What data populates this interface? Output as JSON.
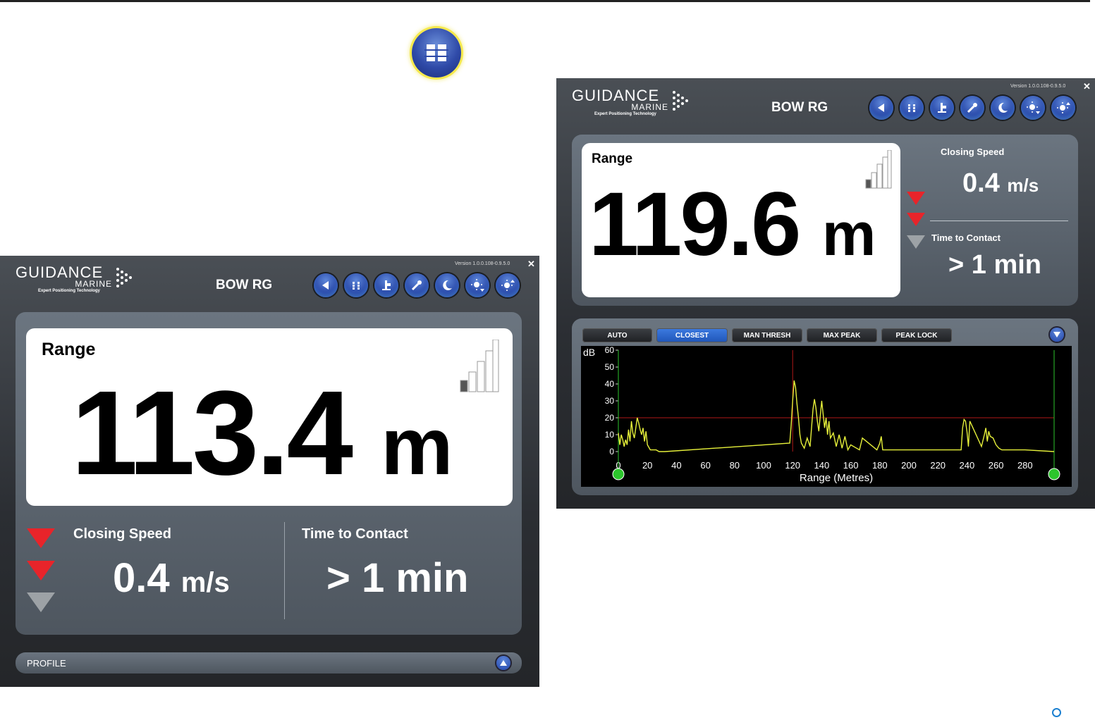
{
  "window1": {
    "logo_main": "GUIDANCE",
    "logo_sub": "MARINE",
    "logo_tag": "Expert Positioning Technology",
    "title": "BOW RG",
    "version": "Version 1.0.0.108-0.9.5.0",
    "close": "✕",
    "range_label": "Range",
    "range_value": "113.4",
    "range_unit": "m",
    "closing_speed_label": "Closing Speed",
    "closing_speed_value": "0.4",
    "closing_speed_unit": "m/s",
    "time_to_contact_label": "Time to Contact",
    "time_to_contact_value": "> 1 min",
    "profile_label": "PROFILE",
    "signal_bars_level": 1
  },
  "window2": {
    "logo_main": "GUIDANCE",
    "logo_sub": "MARINE",
    "logo_tag": "Expert Positioning Technology",
    "title": "BOW RG",
    "version": "Version 1.0.0.108-0.9.5.0",
    "close": "✕",
    "range_label": "Range",
    "range_value": "119.6",
    "range_unit": "m",
    "closing_speed_label": "Closing Speed",
    "closing_speed_value": "0.4",
    "closing_speed_unit": "m/s",
    "time_to_contact_label": "Time to Contact",
    "time_to_contact_value": "> 1 min",
    "signal_bars_level": 1,
    "modes": [
      "AUTO",
      "CLOSEST",
      "MAN THRESH",
      "MAX PEAK",
      "PEAK LOCK"
    ],
    "active_mode": "CLOSEST"
  },
  "toolbar_icons": [
    "back-icon",
    "menu-grid-icon",
    "target-icon",
    "wrench-icon",
    "night-mode-icon",
    "brightness-down-icon",
    "brightness-up-icon"
  ],
  "colors": {
    "alarm_red": "#e8242a",
    "inactive_grey": "#9da2a6",
    "accent_blue": "#2948a8",
    "trace_yellow": "#e6f03a",
    "threshold_red": "#b01818",
    "marker_green": "#2cc52c"
  },
  "chart_data": {
    "type": "line",
    "ylabel": "dB",
    "xlabel": "Range (Metres)",
    "xlim": [
      0,
      300
    ],
    "ylim": [
      0,
      60
    ],
    "xticks": [
      0,
      20,
      40,
      60,
      80,
      100,
      120,
      140,
      160,
      180,
      200,
      220,
      240,
      260,
      280
    ],
    "yticks": [
      0,
      10,
      20,
      30,
      40,
      50,
      60
    ],
    "threshold_db": 20,
    "cursor_range": 120,
    "gate_markers": [
      0,
      300
    ],
    "series": [
      {
        "x": [
          0,
          1,
          2,
          3,
          4,
          5,
          6,
          7,
          8,
          9,
          10,
          11,
          12,
          13,
          14,
          15,
          16,
          17,
          18,
          19,
          20,
          22,
          24,
          26,
          28,
          30,
          32,
          118,
          119,
          120,
          121,
          122,
          123,
          124,
          125,
          126,
          128,
          130,
          132,
          134,
          135,
          136,
          137,
          138,
          140,
          141,
          142,
          143,
          144,
          145,
          146,
          148,
          150,
          152,
          154,
          156,
          158,
          160,
          166,
          168,
          178,
          180,
          181,
          182,
          236,
          237,
          238,
          239,
          240,
          241,
          242,
          250,
          252,
          253,
          254,
          255,
          256,
          258,
          260,
          262,
          264,
          278,
          280,
          300
        ],
        "y": [
          11,
          4,
          10,
          7,
          3,
          7,
          4,
          13,
          6,
          18,
          11,
          8,
          14,
          20,
          17,
          13,
          10,
          14,
          6,
          12,
          4,
          1,
          1,
          1,
          0,
          0,
          0,
          5,
          16,
          30,
          42,
          38,
          28,
          20,
          10,
          5,
          2,
          8,
          3,
          25,
          31,
          26,
          18,
          12,
          30,
          22,
          14,
          20,
          10,
          18,
          8,
          11,
          3,
          10,
          2,
          9,
          1,
          4,
          1,
          8,
          1,
          5,
          9,
          1,
          1,
          14,
          19,
          18,
          12,
          3,
          18,
          3,
          10,
          14,
          6,
          12,
          9,
          8,
          4,
          2,
          1,
          1,
          1,
          0
        ]
      }
    ]
  }
}
